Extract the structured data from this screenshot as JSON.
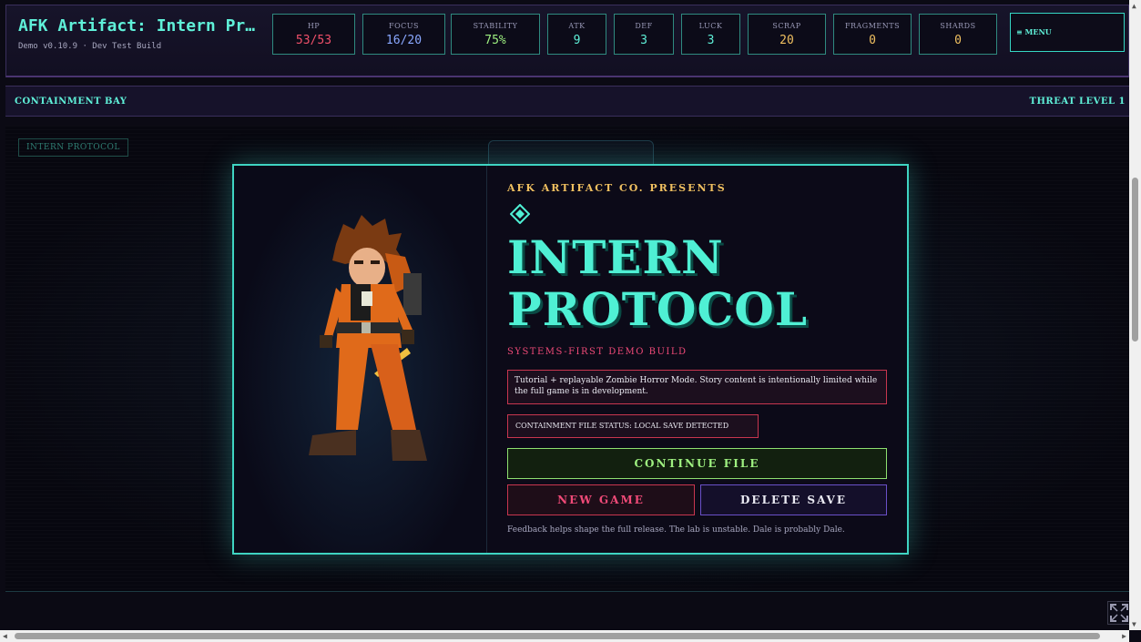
{
  "header": {
    "title": "AFK Artifact: Intern Protocol",
    "subtitle": "Demo v0.10.9 · Dev Test Build",
    "menu_label": "≡ MENU",
    "stats": [
      {
        "label": "HP",
        "value": "53/53",
        "color": "#f0506a"
      },
      {
        "label": "FOCUS",
        "value": "16/20",
        "color": "#8aa8ff"
      },
      {
        "label": "STABILITY",
        "value": "75%",
        "color": "#9ef080"
      },
      {
        "label": "ATK",
        "value": "9",
        "color": "#5ff0d8"
      },
      {
        "label": "DEF",
        "value": "3",
        "color": "#5ff0d8"
      },
      {
        "label": "LUCK",
        "value": "3",
        "color": "#5ff0d8"
      },
      {
        "label": "SCRAP",
        "value": "20",
        "color": "#f0c060"
      },
      {
        "label": "FRAGMENTS",
        "value": "0",
        "color": "#f0c060"
      },
      {
        "label": "SHARDS",
        "value": "0",
        "color": "#f0c060"
      }
    ]
  },
  "location": {
    "name": "CONTAINMENT BAY",
    "threat": "THREAT LEVEL 1"
  },
  "stage": {
    "tag": "INTERN PROTOCOL"
  },
  "modal": {
    "presents": "AFK ARTIFACT CO. PRESENTS",
    "title_line1": "INTERN",
    "title_line2": "PROTOCOL",
    "subtitle": "SYSTEMS-FIRST DEMO BUILD",
    "description": "Tutorial + replayable Zombie Horror Mode. Story content is intentionally limited while the full game is in development.",
    "status": "CONTAINMENT FILE STATUS: LOCAL SAVE DETECTED",
    "continue_label": "CONTINUE FILE",
    "new_game_label": "NEW GAME",
    "delete_save_label": "DELETE SAVE",
    "feedback": "Feedback helps shape the full release. The lab is unstable. Dale is probably Dale."
  },
  "colors": {
    "accent": "#4ff0d4",
    "danger": "#f04a78",
    "gold": "#f0c060",
    "success": "#9ef080"
  }
}
